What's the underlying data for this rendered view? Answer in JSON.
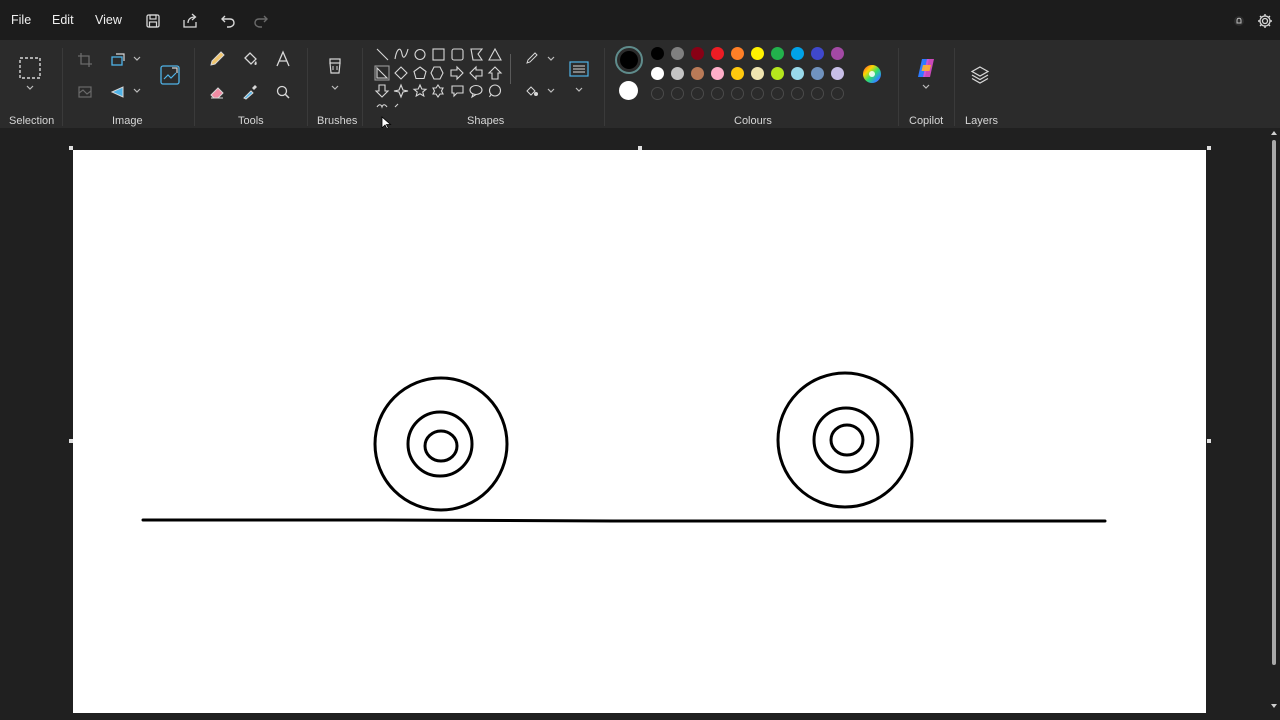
{
  "menu": {
    "file": "File",
    "edit": "Edit",
    "view": "View"
  },
  "ribbon": {
    "selection_label": "Selection",
    "image_label": "Image",
    "tools_label": "Tools",
    "brushes_label": "Brushes",
    "shapes_label": "Shapes",
    "colours_label": "Colours",
    "copilot_label": "Copilot",
    "layers_label": "Layers"
  },
  "colours": {
    "primary": "#000000",
    "secondary": "#ffffff",
    "row1": [
      "#000000",
      "#7f7f7f",
      "#880015",
      "#ed1c24",
      "#ff7f27",
      "#fff200",
      "#22b14c",
      "#00a2e8",
      "#3f48cc",
      "#a349a4"
    ],
    "row2": [
      "#ffffff",
      "#c3c3c3",
      "#b97a57",
      "#ffaec9",
      "#ffc90e",
      "#efe4b0",
      "#b5e61d",
      "#99d9ea",
      "#7092be",
      "#c8bfe7"
    ]
  },
  "icons": {
    "save": "save-icon",
    "share": "share-icon",
    "undo": "undo-icon",
    "redo": "redo-icon",
    "settings": "gear-icon",
    "notification": "notification-icon"
  }
}
